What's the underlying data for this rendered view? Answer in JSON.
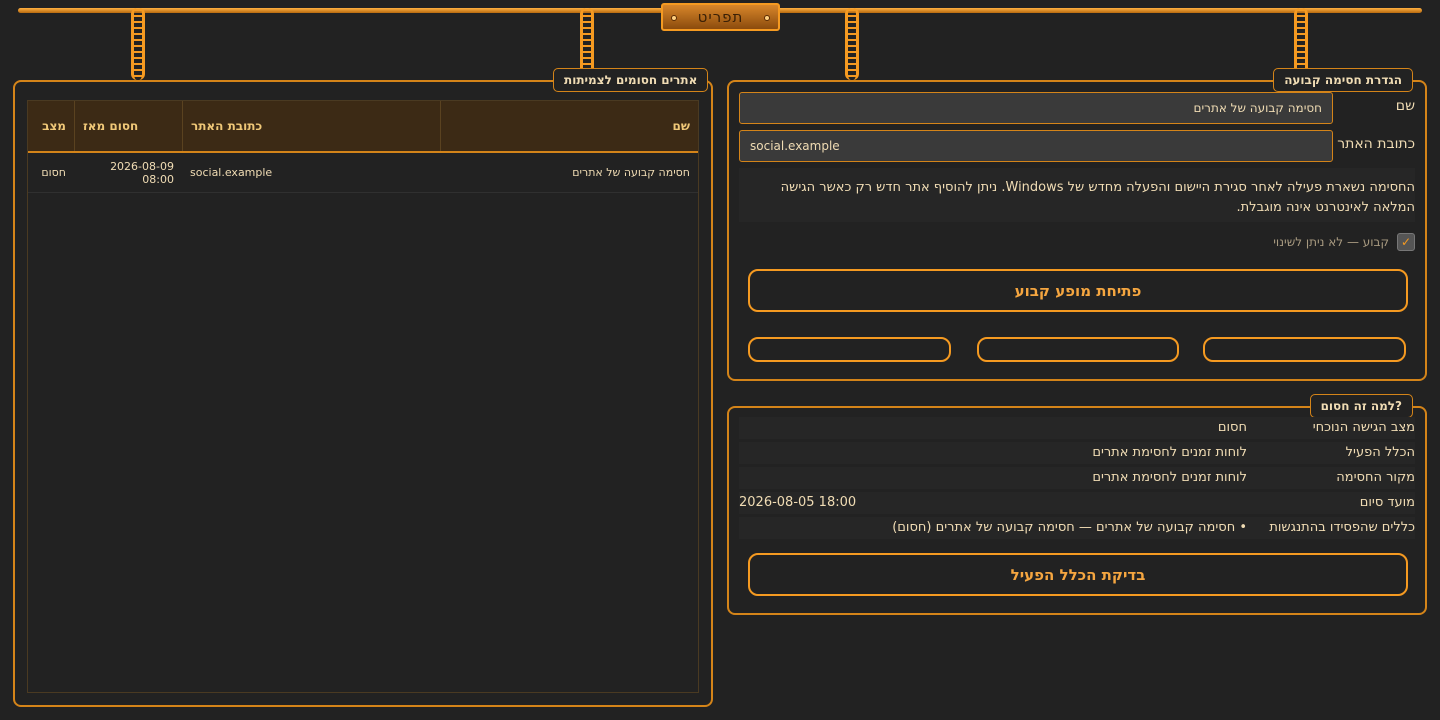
{
  "menu": {
    "label": "תפריט"
  },
  "blocked_sites": {
    "title": "אתרים חסומים לצמיתות",
    "columns": {
      "name": "שם",
      "url": "כתובת האתר",
      "since": "חסום מאז",
      "status": "מצב"
    },
    "rows": [
      {
        "name": "חסימה קבועה של אתרים",
        "url": "social.example",
        "since": "2026-08-09 08:00",
        "status": "חסום"
      }
    ]
  },
  "definition": {
    "title": "הגדרת חסימה קבועה",
    "name_label": "שם",
    "name_value": "חסימה קבועה של אתרים",
    "url_label": "כתובת האתר",
    "url_value": "social.example",
    "notice": "החסימה נשארת פעילה לאחר סגירת היישום והפעלה מחדש של Windows. ניתן להוסיף אתר חדש רק כאשר הגישה המלאה לאינטרנט אינה מוגבלת.",
    "permanent_label": "קבוע — לא ניתן לשינוי",
    "permanent_checked": true,
    "open_button": "פתיחת מופע קבוע",
    "action_buttons": [
      "",
      "",
      ""
    ]
  },
  "why": {
    "title": "?למה זה חסום",
    "rows": [
      {
        "key": "מצב הגישה הנוכחי",
        "value": "חסום"
      },
      {
        "key": "הכלל הפעיל",
        "value": "לוחות זמנים לחסימת אתרים"
      },
      {
        "key": "מקור החסימה",
        "value": "לוחות זמנים לחסימת אתרים"
      },
      {
        "key": "מועד סיום",
        "value": "2026-08-05 18:00"
      },
      {
        "key": "כללים שהפסידו בהתנגשות",
        "value": "• חסימה קבועה של אתרים — חסימה קבועה של אתרים (חסום)"
      }
    ],
    "check_button": "בדיקת הכלל הפעיל"
  },
  "colors": {
    "accent": "#f59a21",
    "background": "#222222",
    "text": "#f0dcb4"
  }
}
